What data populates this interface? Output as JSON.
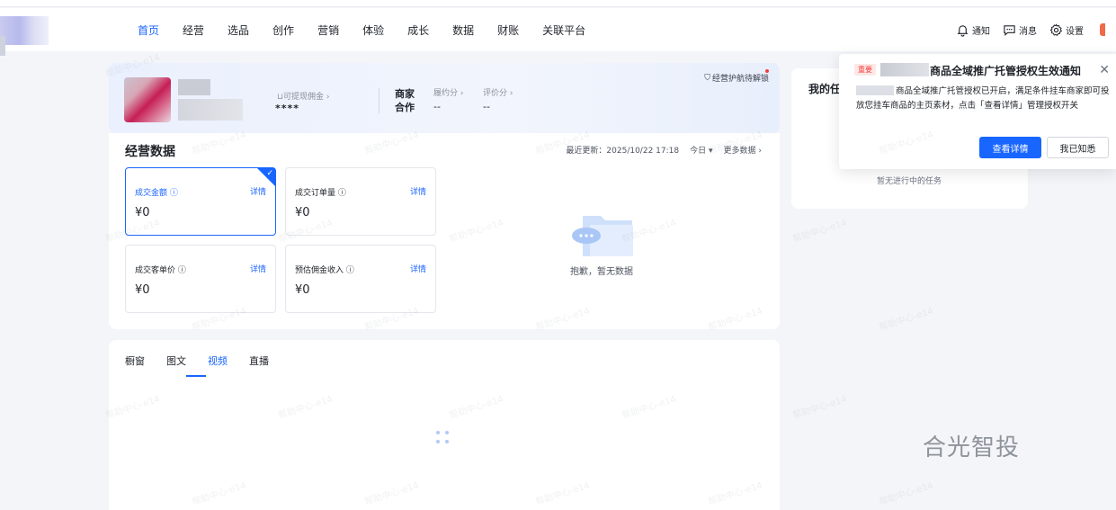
{
  "nav": {
    "items": [
      "首页",
      "经营",
      "选品",
      "创作",
      "营销",
      "体验",
      "成长",
      "数据",
      "财账",
      "关联平台"
    ],
    "active_index": 0
  },
  "header_right": {
    "notify": "通知",
    "message": "消息",
    "settings": "设置"
  },
  "profile": {
    "withdraw_label": "可提现佣金",
    "withdraw_value": "****",
    "merchant_label_line1": "商家",
    "merchant_label_line2": "合作",
    "perf_label": "履约分",
    "perf_value": "--",
    "review_label": "评价分",
    "review_value": "--",
    "guard_label": "经营护航待解锁"
  },
  "business": {
    "title": "经营数据",
    "last_update": "最近更新：2025/10/22 17:18",
    "period": "今日",
    "more": "更多数据",
    "metrics": [
      {
        "label": "成交金额",
        "detail": "详情",
        "value": "¥0"
      },
      {
        "label": "成交订单量",
        "detail": "详情",
        "value": "¥0"
      },
      {
        "label": "成交客单价",
        "detail": "详情",
        "value": "¥0"
      },
      {
        "label": "预估佣金收入",
        "detail": "详情",
        "value": "¥0"
      }
    ],
    "empty_text": "抱歉，暂无数据"
  },
  "content_tabs": {
    "items": [
      "橱窗",
      "图文",
      "视频",
      "直播"
    ],
    "active_index": 2
  },
  "tasks": {
    "title": "我的任",
    "empty": "暂无进行中的任务"
  },
  "notice": {
    "tag": "重要",
    "title": "商品全域推广托管授权生效通知",
    "body": "商品全域推广托管授权已开启，满足条件挂车商家即可投放您挂车商品的主页素材，点击「查看详情」管理授权开关",
    "primary_button": "查看详情",
    "secondary_button": "我已知悉"
  },
  "watermark_text": "帮助中心-e14",
  "brand_watermark": "合光智投",
  "colors": {
    "accent": "#1966ff",
    "danger": "#f53f3f"
  }
}
